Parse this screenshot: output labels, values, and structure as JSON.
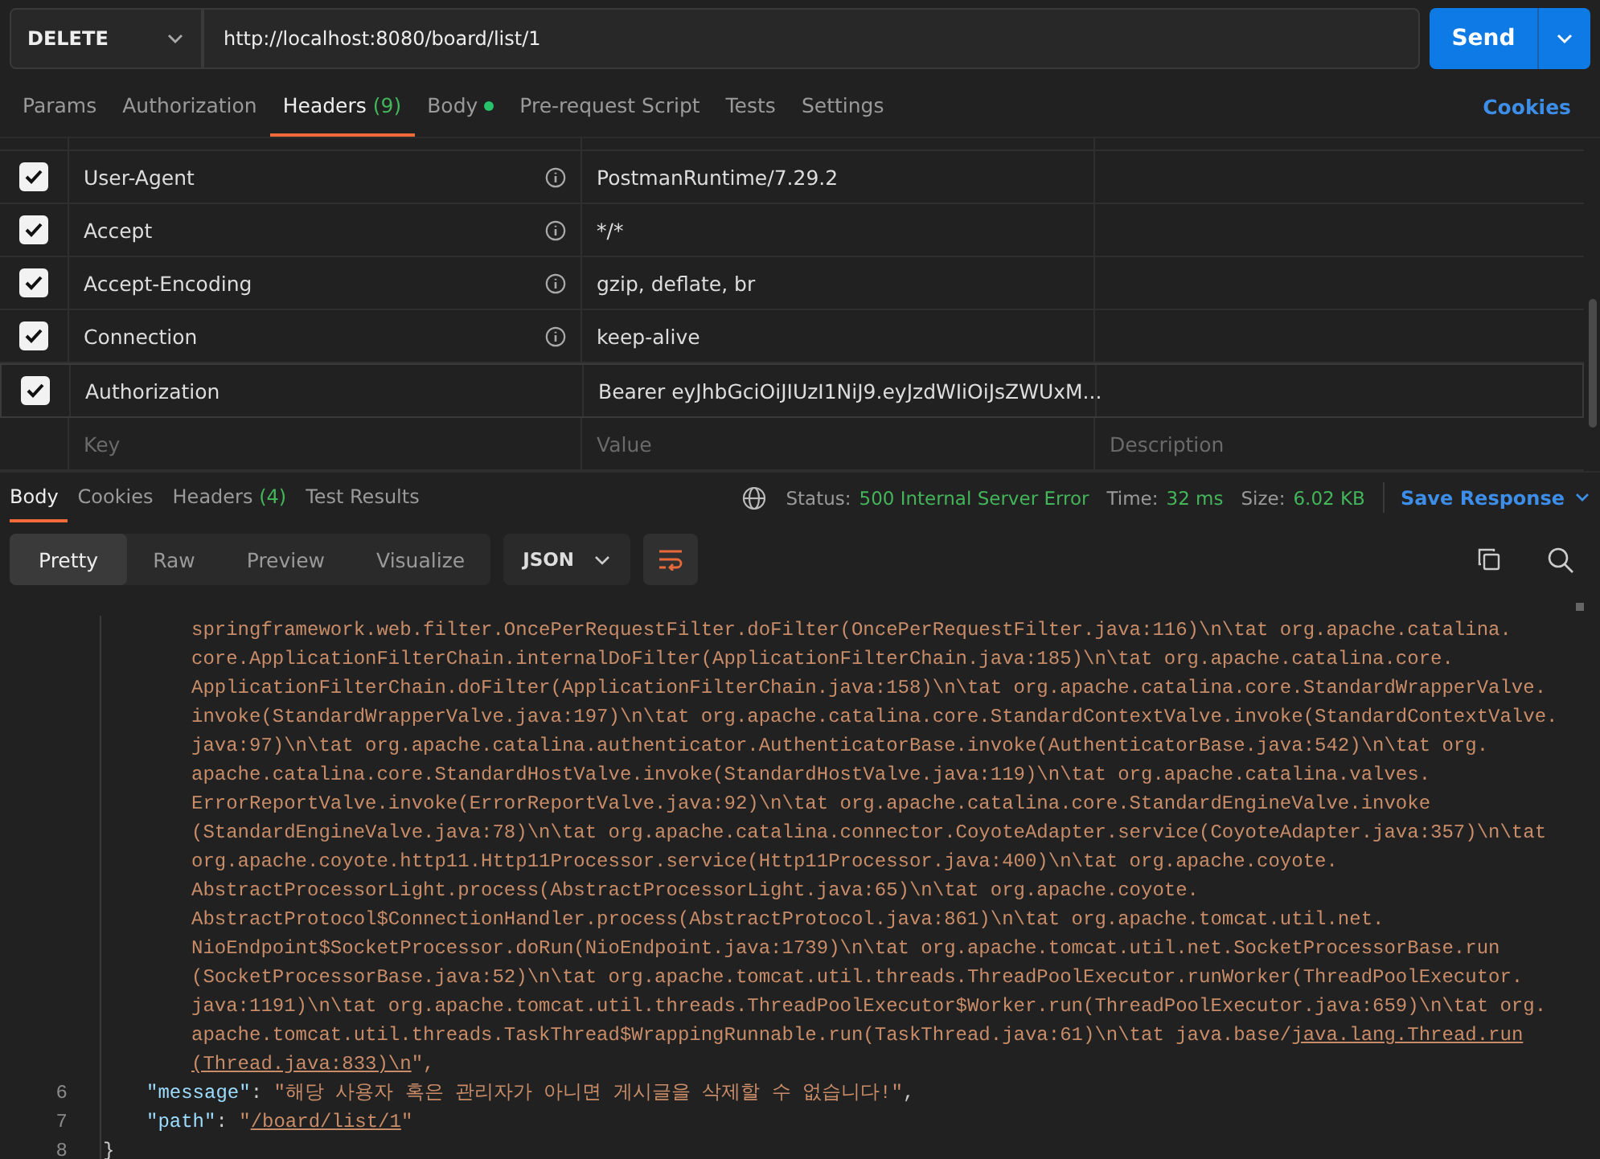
{
  "request": {
    "method": "DELETE",
    "url": "http://localhost:8080/board/list/1",
    "send_label": "Send"
  },
  "request_tabs": [
    {
      "label": "Params",
      "selected": false
    },
    {
      "label": "Authorization",
      "selected": false
    },
    {
      "label": "Headers",
      "count": "(9)",
      "selected": true
    },
    {
      "label": "Body",
      "dot": true,
      "selected": false
    },
    {
      "label": "Pre-request Script",
      "selected": false
    },
    {
      "label": "Tests",
      "selected": false
    },
    {
      "label": "Settings",
      "selected": false
    }
  ],
  "cookies_link": "Cookies",
  "headers": {
    "rows": [
      {
        "key": "User-Agent",
        "value": "PostmanRuntime/7.29.2",
        "checked": true,
        "info_icon": true,
        "hovered": false
      },
      {
        "key": "Accept",
        "value": "*/*",
        "checked": true,
        "info_icon": true,
        "hovered": false
      },
      {
        "key": "Accept-Encoding",
        "value": "gzip, deflate, br",
        "checked": true,
        "info_icon": true,
        "hovered": false
      },
      {
        "key": "Connection",
        "value": "keep-alive",
        "checked": true,
        "info_icon": true,
        "hovered": false
      },
      {
        "key": "Authorization",
        "value": "Bearer eyJhbGciOiJIUzI1NiJ9.eyJzdWIiOiJsZWUxM...",
        "checked": true,
        "info_icon": false,
        "hovered": true
      }
    ],
    "new_row": {
      "key_placeholder": "Key",
      "value_placeholder": "Value",
      "description_placeholder": "Description"
    }
  },
  "response_tabs": [
    {
      "label": "Body",
      "selected": true
    },
    {
      "label": "Cookies",
      "selected": false
    },
    {
      "label": "Headers",
      "count": "(4)",
      "selected": false
    },
    {
      "label": "Test Results",
      "selected": false
    }
  ],
  "status": {
    "status_label": "Status:",
    "status_value": "500 Internal Server Error",
    "time_label": "Time:",
    "time_value": "32 ms",
    "size_label": "Size:",
    "size_value": "6.02 KB"
  },
  "save_response": "Save Response",
  "view_modes": [
    {
      "label": "Pretty",
      "selected": true
    },
    {
      "label": "Raw",
      "selected": false
    },
    {
      "label": "Preview",
      "selected": false
    },
    {
      "label": "Visualize",
      "selected": false
    }
  ],
  "format": "JSON",
  "wrap_on": true,
  "code_lines": [
    {
      "kind": "wrap",
      "segments": [
        {
          "text": "springframework.web.filter.OncePerRequestFilter.doFilter(OncePerRequestFilter.java:116)\\n\\tat org.apache.catalina."
        }
      ]
    },
    {
      "kind": "wrap",
      "segments": [
        {
          "text": "core.ApplicationFilterChain.internalDoFilter(ApplicationFilterChain.java:185)\\n\\tat org.apache.catalina.core."
        }
      ]
    },
    {
      "kind": "wrap",
      "segments": [
        {
          "text": "ApplicationFilterChain.doFilter(ApplicationFilterChain.java:158)\\n\\tat org.apache.catalina.core.StandardWrapperValve."
        }
      ]
    },
    {
      "kind": "wrap",
      "segments": [
        {
          "text": "invoke(StandardWrapperValve.java:197)\\n\\tat org.apache.catalina.core.StandardContextValve.invoke(StandardContextValve."
        }
      ]
    },
    {
      "kind": "wrap",
      "segments": [
        {
          "text": "java:97)\\n\\tat org.apache.catalina.authenticator.AuthenticatorBase.invoke(AuthenticatorBase.java:542)\\n\\tat org."
        }
      ]
    },
    {
      "kind": "wrap",
      "segments": [
        {
          "text": "apache.catalina.core.StandardHostValve.invoke(StandardHostValve.java:119)\\n\\tat org.apache.catalina.valves."
        }
      ]
    },
    {
      "kind": "wrap",
      "segments": [
        {
          "text": "ErrorReportValve.invoke(ErrorReportValve.java:92)\\n\\tat org.apache.catalina.core.StandardEngineValve.invoke"
        }
      ]
    },
    {
      "kind": "wrap",
      "segments": [
        {
          "text": "(StandardEngineValve.java:78)\\n\\tat org.apache.catalina.connector.CoyoteAdapter.service(CoyoteAdapter.java:357)\\n\\tat"
        }
      ]
    },
    {
      "kind": "wrap",
      "segments": [
        {
          "text": "org.apache.coyote.http11.Http11Processor.service(Http11Processor.java:400)\\n\\tat org.apache.coyote."
        }
      ]
    },
    {
      "kind": "wrap",
      "segments": [
        {
          "text": "AbstractProcessorLight.process(AbstractProcessorLight.java:65)\\n\\tat org.apache.coyote."
        }
      ]
    },
    {
      "kind": "wrap",
      "segments": [
        {
          "text": "AbstractProtocol$ConnectionHandler.process(AbstractProtocol.java:861)\\n\\tat org.apache.tomcat.util.net."
        }
      ]
    },
    {
      "kind": "wrap",
      "segments": [
        {
          "text": "NioEndpoint$SocketProcessor.doRun(NioEndpoint.java:1739)\\n\\tat org.apache.tomcat.util.net.SocketProcessorBase.run"
        }
      ]
    },
    {
      "kind": "wrap",
      "segments": [
        {
          "text": "(SocketProcessorBase.java:52)\\n\\tat org.apache.tomcat.util.threads.ThreadPoolExecutor.runWorker(ThreadPoolExecutor."
        }
      ]
    },
    {
      "kind": "wrap",
      "segments": [
        {
          "text": "java:1191)\\n\\tat org.apache.tomcat.util.threads.ThreadPoolExecutor$Worker.run(ThreadPoolExecutor.java:659)\\n\\tat org."
        }
      ]
    },
    {
      "kind": "wrap",
      "segments": [
        {
          "text": "apache.tomcat.util.threads.TaskThread$WrappingRunnable.run(TaskThread.java:61)\\n\\tat java.base/",
          "kind": "string"
        },
        {
          "text": "java.lang.Thread.run",
          "kind": "link"
        }
      ]
    },
    {
      "kind": "wrap",
      "segments": [
        {
          "text": "(Thread.java:833)\\n",
          "kind": "link"
        },
        {
          "text": "\",",
          "kind": "string"
        }
      ]
    },
    {
      "kind": "pair",
      "number": "6",
      "segments": [
        {
          "text": "\"message\"",
          "kind": "key"
        },
        {
          "text": ": ",
          "kind": "punct"
        },
        {
          "text": "\"해당 사용자 혹은 관리자가 아니면 게시글을 삭제할 수 없습니다!\"",
          "kind": "string"
        },
        {
          "text": ",",
          "kind": "punct"
        }
      ]
    },
    {
      "kind": "pair",
      "number": "7",
      "segments": [
        {
          "text": "\"path\"",
          "kind": "key"
        },
        {
          "text": ": ",
          "kind": "punct"
        },
        {
          "text": "\"",
          "kind": "string"
        },
        {
          "text": "/board/list/1",
          "kind": "link"
        },
        {
          "text": "\"",
          "kind": "string"
        }
      ]
    },
    {
      "kind": "close",
      "number": "8",
      "text": "}"
    }
  ]
}
